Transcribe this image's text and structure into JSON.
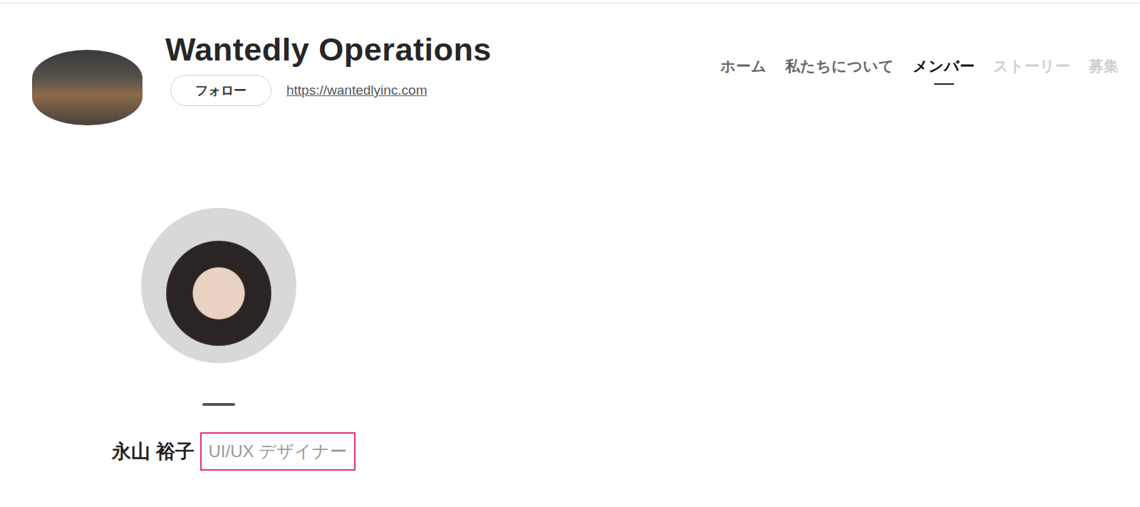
{
  "company": {
    "name": "Wantedly Operations",
    "follow_button": "フォロー",
    "url": "https://wantedlyinc.com"
  },
  "nav": [
    {
      "label": "ホーム",
      "selected": false,
      "dimmed": false
    },
    {
      "label": "私たちについて",
      "selected": false,
      "dimmed": false
    },
    {
      "label": "メンバー",
      "selected": true,
      "dimmed": false
    },
    {
      "label": "ストーリー",
      "selected": false,
      "dimmed": true
    },
    {
      "label": "募集",
      "selected": false,
      "dimmed": true
    }
  ],
  "member": {
    "name": "永山 裕子",
    "role": "UI/UX デザイナー",
    "role_highlighted": true
  }
}
